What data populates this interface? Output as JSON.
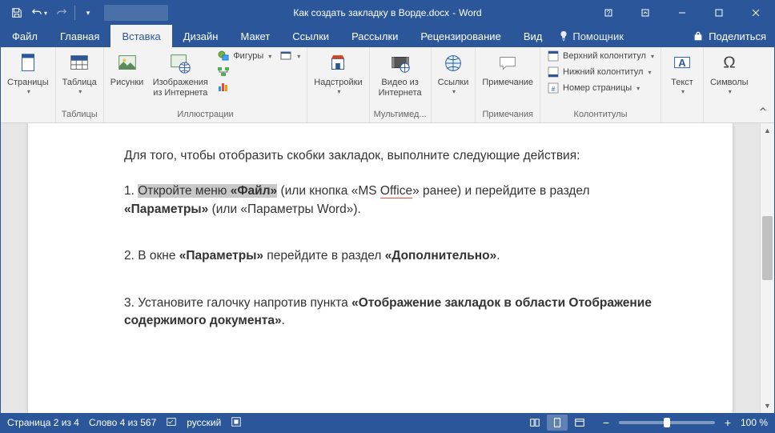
{
  "title_doc": "Как создать закладку в Ворде.docx",
  "title_app": "Word",
  "tabs": {
    "file": "Файл",
    "home": "Главная",
    "insert": "Вставка",
    "design": "Дизайн",
    "layout": "Макет",
    "references": "Ссылки",
    "mailings": "Рассылки",
    "review": "Рецензирование",
    "view": "Вид"
  },
  "tell_me": "Помощник",
  "share": "Поделиться",
  "ribbon": {
    "pages": {
      "label": "Страницы",
      "btn": "Страницы"
    },
    "tables": {
      "label": "Таблицы",
      "btn": "Таблица"
    },
    "illustr": {
      "label": "Иллюстрации",
      "pictures": "Рисунки",
      "online": "Изображения из Интернета",
      "shapes": "Фигуры",
      "smartart": "",
      "chart": "",
      "screenshot": ""
    },
    "addins": {
      "label": "",
      "btn": "Надстройки"
    },
    "media": {
      "label": "Мультимед...",
      "btn": "Видео из Интернета"
    },
    "links": {
      "label": "",
      "btn": "Ссылки"
    },
    "comments": {
      "label": "Примечания",
      "btn": "Примечание"
    },
    "headerfooter": {
      "label": "Колонтитулы",
      "header": "Верхний колонтитул",
      "footer": "Нижний колонтитул",
      "pagenum": "Номер страницы"
    },
    "text": {
      "label": "",
      "btn": "Текст"
    },
    "symbols": {
      "label": "",
      "btn": "Символы"
    }
  },
  "doc": {
    "p1_a": "Для того, чтобы отобразить скобки закладок, выполните следующие действия:",
    "p2_pre": "1. ",
    "p2_sel": "Откройте меню ",
    "p2_sel_b": "«Файл»",
    "p2_mid": " (или кнопка «MS ",
    "p2_off": "Office",
    "p2_mid2": "» ранее) и перейдите в раздел ",
    "p2_b2": "«Параметры»",
    "p2_end": " (или «Параметры Word»).",
    "p3_a": "2. В окне ",
    "p3_b1": "«Параметры»",
    "p3_mid": " перейдите в раздел ",
    "p3_b2": "«Дополнительно»",
    "p3_end": ".",
    "p4_a": "3. Установите галочку напротив пункта ",
    "p4_b": "«Отображение закладок в области Отображение содержимого документа»",
    "p4_end": "."
  },
  "status": {
    "page": "Страница 2 из 4",
    "words": "Слово 4 из 567",
    "lang": "русский",
    "zoom": "100 %"
  }
}
